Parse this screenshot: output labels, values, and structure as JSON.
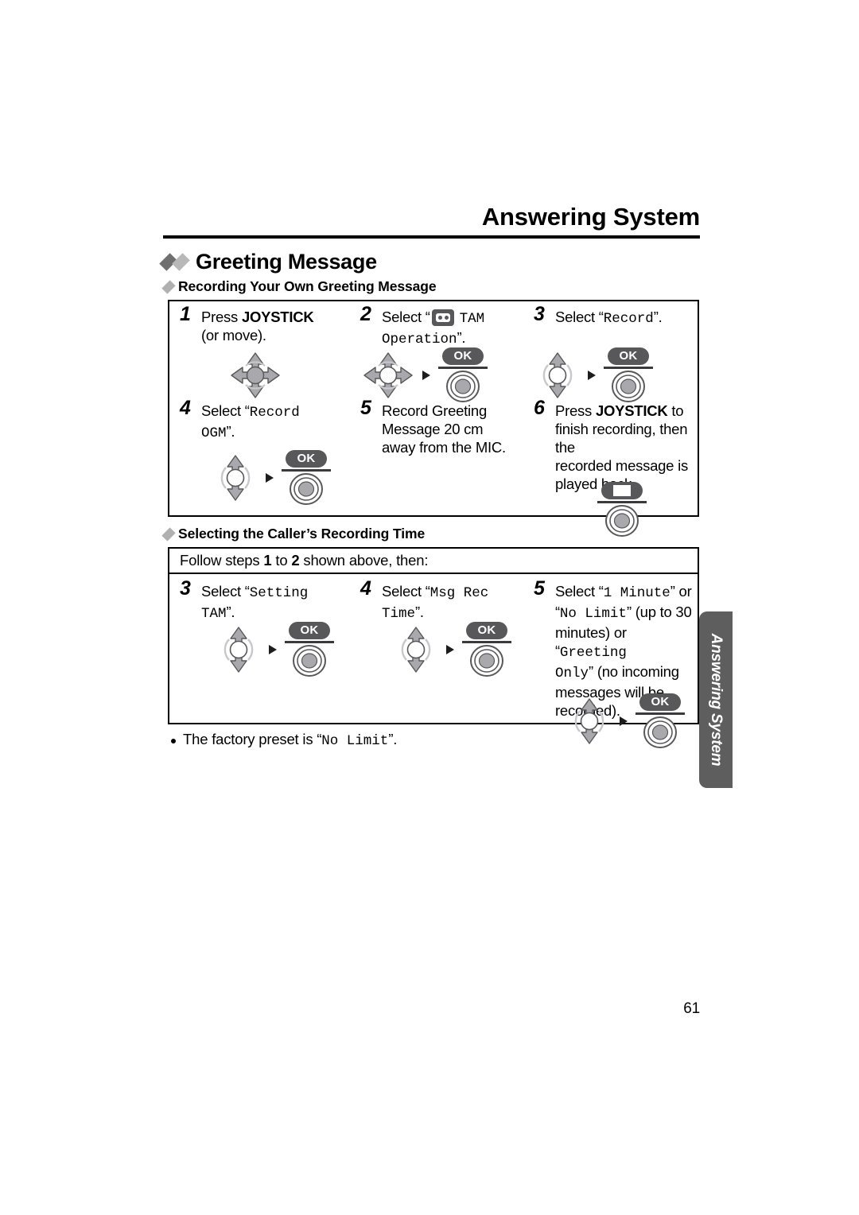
{
  "header": {
    "title": "Answering System"
  },
  "section": {
    "title": "Greeting Message"
  },
  "subsections": [
    {
      "title": "Recording Your Own Greeting Message"
    },
    {
      "title": "Selecting the Caller’s Recording Time"
    }
  ],
  "recording_steps": {
    "step1": {
      "num": "1",
      "line1_pre": "Press ",
      "line1_bold": "JOYSTICK",
      "line2": "(or move)."
    },
    "step2": {
      "num": "2",
      "pre": "Select “",
      "icon": "tam-cassette-icon",
      "mono1": "TAM",
      "mono2": "Operation",
      "post": "”.",
      "ok_label": "OK"
    },
    "step3": {
      "num": "3",
      "pre": "Select “",
      "mono": "Record",
      "post": "”.",
      "ok_label": "OK"
    },
    "step4": {
      "num": "4",
      "pre": "Select “",
      "mono1": "Record",
      "mono2": "OGM",
      "post": "”.",
      "ok_label": "OK"
    },
    "step5": {
      "num": "5",
      "line1": "Record Greeting",
      "line2": "Message 20 cm",
      "line3": "away from the MIC."
    },
    "step6": {
      "num": "6",
      "line1_pre": "Press ",
      "line1_bold": "JOYSTICK",
      "line1_post": " to",
      "line2": "finish recording, then the",
      "line3": "recorded message is",
      "line4": "played back.",
      "ok_label": ""
    }
  },
  "rectime": {
    "follow_pre": "Follow steps ",
    "follow_num1": "1",
    "follow_mid": " to ",
    "follow_num2": "2",
    "follow_post": " shown above, then:",
    "step3": {
      "num": "3",
      "pre": "Select “",
      "mono1": "Setting",
      "mono2": "TAM",
      "post": "”.",
      "ok_label": "OK"
    },
    "step4": {
      "num": "4",
      "pre": "Select “",
      "mono1": "Msg Rec",
      "mono2": "Time",
      "post": "”.",
      "ok_label": "OK"
    },
    "step5": {
      "num": "5",
      "l1_pre": "Select “",
      "l1_mono": "1 Minute",
      "l1_post": "” or",
      "l2_pre": "“",
      "l2_mono": "No Limit",
      "l2_post": "” (up to 30",
      "l3_pre": "minutes) or “",
      "l3_mono": "Greeting",
      "l4_mono": "Only",
      "l4_post": "” (no incoming",
      "l5": "messages will be",
      "l6": "recorded).",
      "ok_label": "OK"
    }
  },
  "note": {
    "pre": "The factory preset is “",
    "mono": "No Limit",
    "post": "”."
  },
  "side_tab": {
    "label": "Answering System"
  },
  "page_number": "61",
  "colors": {
    "tab_gray": "#5e5e5e",
    "ok_gray": "#58585a",
    "diamond_dark": "#6f6f6f",
    "diamond_light": "#b8b8b8",
    "joystick_gray": "#a8a8ad"
  }
}
